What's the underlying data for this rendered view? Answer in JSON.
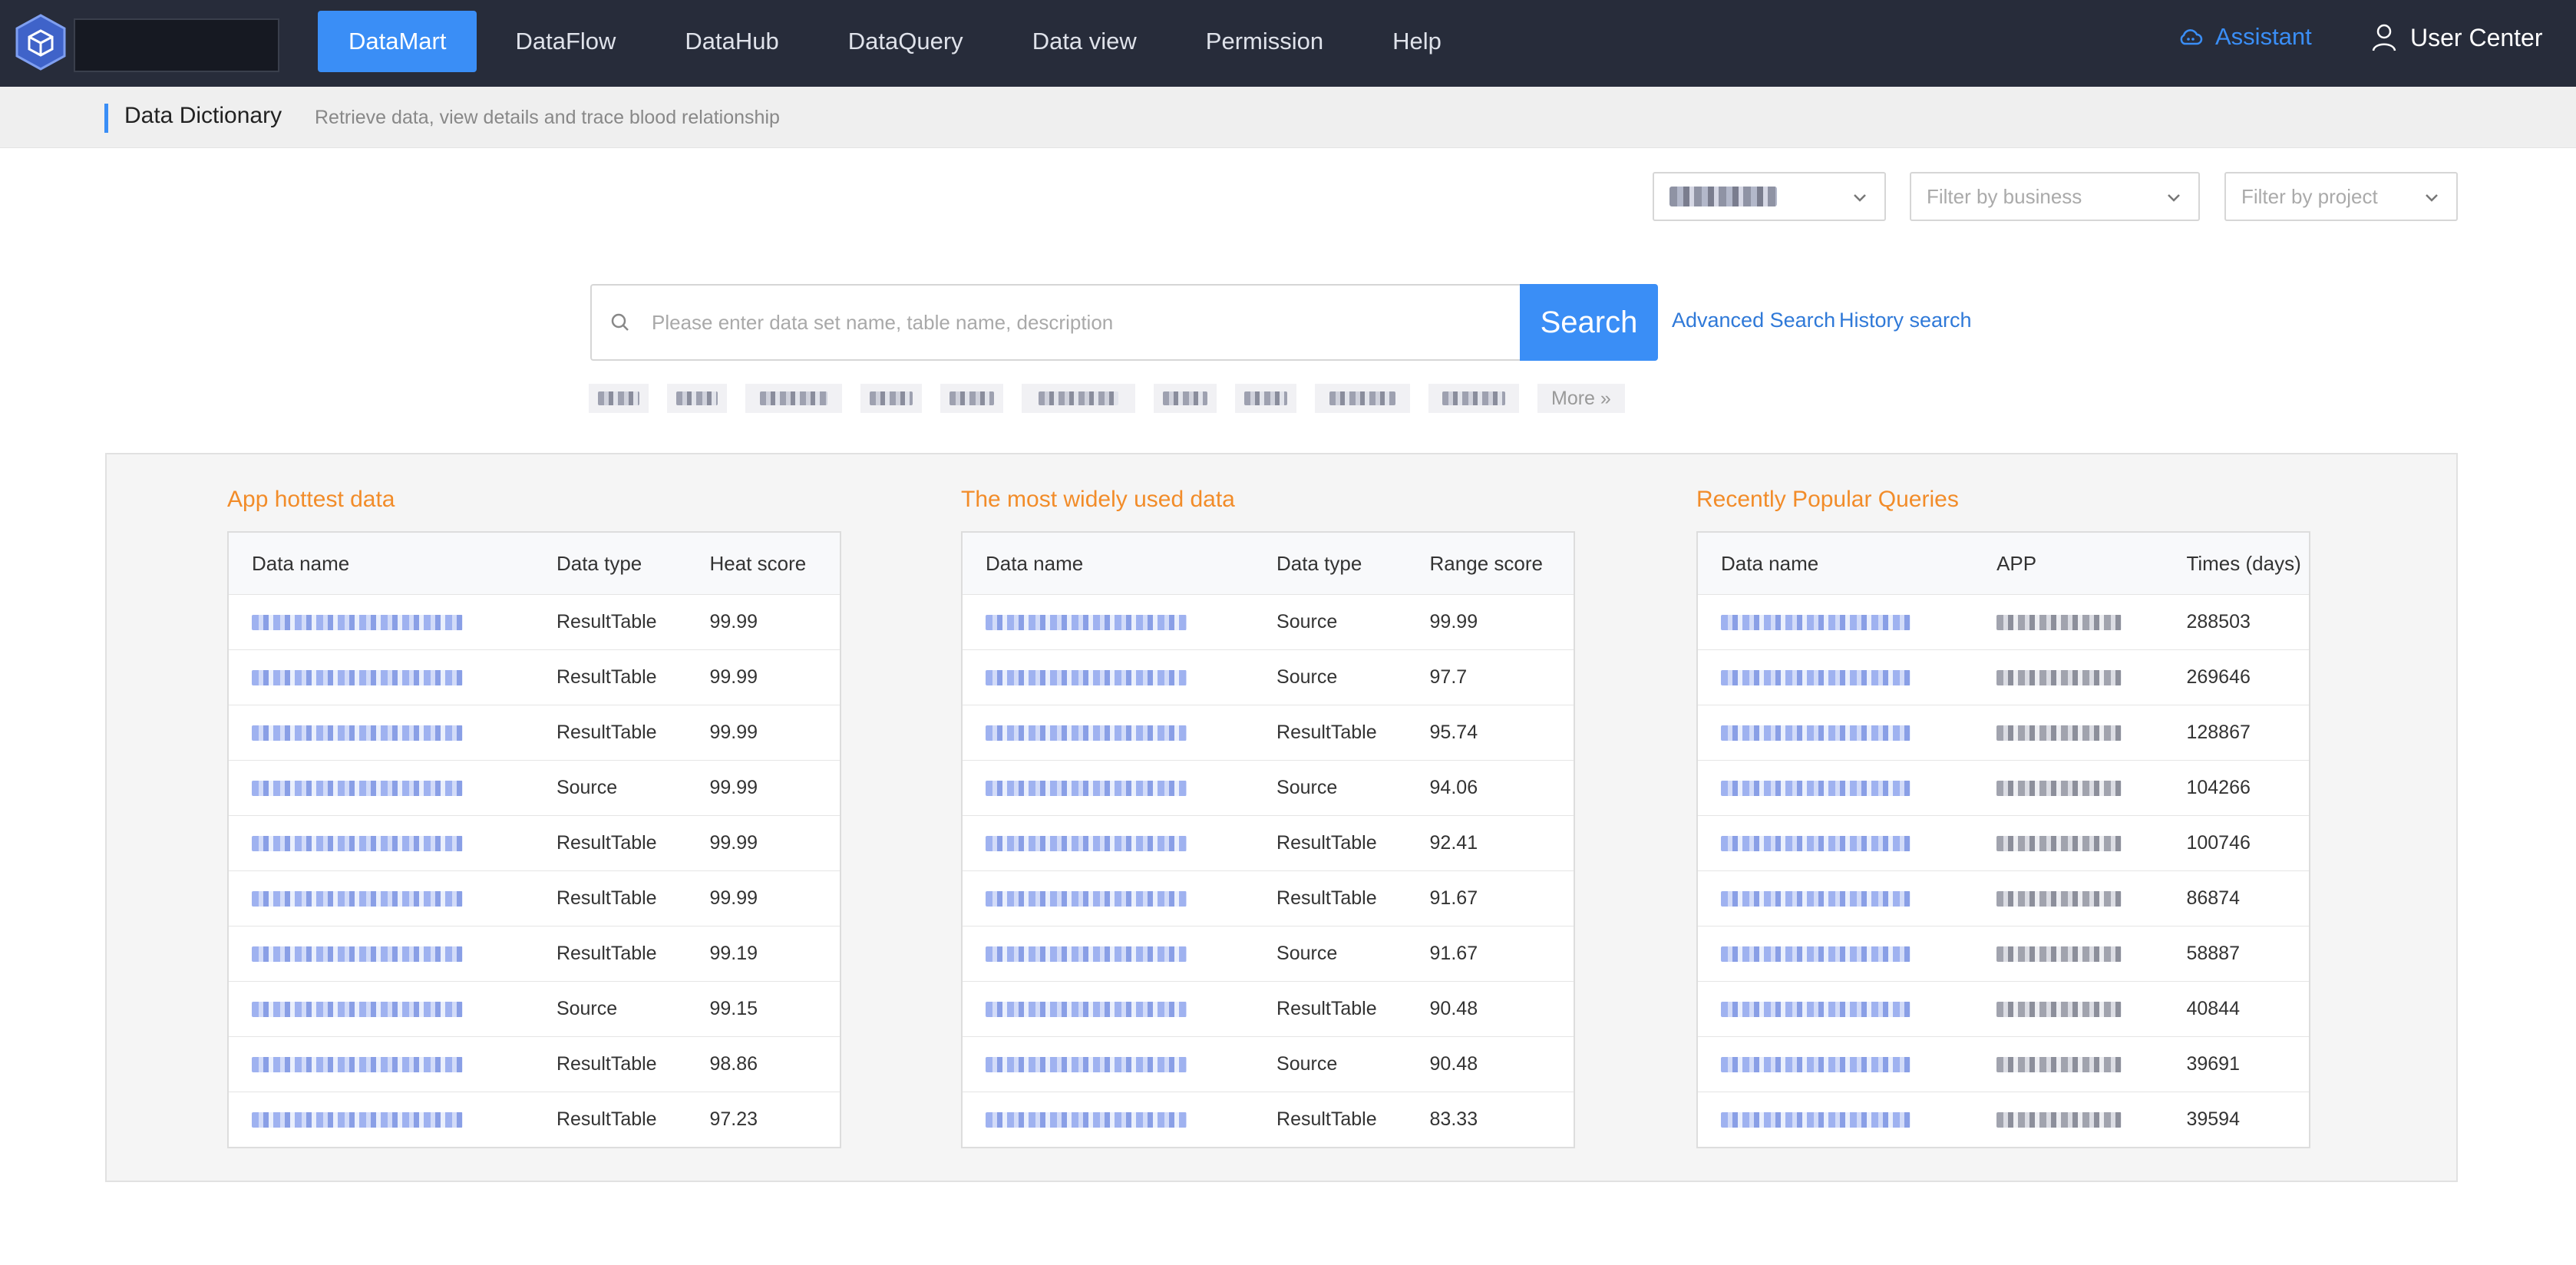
{
  "nav": {
    "items": [
      {
        "label": "DataMart",
        "active": true
      },
      {
        "label": "DataFlow",
        "active": false
      },
      {
        "label": "DataHub",
        "active": false
      },
      {
        "label": "DataQuery",
        "active": false
      },
      {
        "label": "Data view",
        "active": false
      },
      {
        "label": "Permission",
        "active": false
      },
      {
        "label": "Help",
        "active": false
      }
    ],
    "assistant": "Assistant",
    "user_center": "User Center",
    "accent_color": "#3a8ef6",
    "background_color": "#272c3a"
  },
  "subheader": {
    "title": "Data Dictionary",
    "description": "Retrieve data, view details and trace blood relationship"
  },
  "filters": {
    "first_value": "",
    "business_placeholder": "Filter by business",
    "project_placeholder": "Filter by project"
  },
  "search": {
    "placeholder": "Please enter data set name, table name, description",
    "button": "Search",
    "advanced": "Advanced Search",
    "history": "History search",
    "more_tag": "More »"
  },
  "hottest": {
    "title": "App hottest data",
    "columns": [
      "Data name",
      "Data type",
      "Heat score"
    ],
    "rows": [
      {
        "name": "",
        "type": "ResultTable",
        "score": "99.99"
      },
      {
        "name": "",
        "type": "ResultTable",
        "score": "99.99"
      },
      {
        "name": "",
        "type": "ResultTable",
        "score": "99.99"
      },
      {
        "name": "",
        "type": "Source",
        "score": "99.99"
      },
      {
        "name": "",
        "type": "ResultTable",
        "score": "99.99"
      },
      {
        "name": "",
        "type": "ResultTable",
        "score": "99.99"
      },
      {
        "name": "",
        "type": "ResultTable",
        "score": "99.19"
      },
      {
        "name": "",
        "type": "Source",
        "score": "99.15"
      },
      {
        "name": "",
        "type": "ResultTable",
        "score": "98.86"
      },
      {
        "name": "",
        "type": "ResultTable",
        "score": "97.23"
      }
    ]
  },
  "widely_used": {
    "title": "The most widely used data",
    "columns": [
      "Data name",
      "Data type",
      "Range score"
    ],
    "rows": [
      {
        "name": "",
        "type": "Source",
        "score": "99.99"
      },
      {
        "name": "",
        "type": "Source",
        "score": "97.7"
      },
      {
        "name": "",
        "type": "ResultTable",
        "score": "95.74"
      },
      {
        "name": "",
        "type": "Source",
        "score": "94.06"
      },
      {
        "name": "",
        "type": "ResultTable",
        "score": "92.41"
      },
      {
        "name": "",
        "type": "ResultTable",
        "score": "91.67"
      },
      {
        "name": "",
        "type": "Source",
        "score": "91.67"
      },
      {
        "name": "",
        "type": "ResultTable",
        "score": "90.48"
      },
      {
        "name": "",
        "type": "Source",
        "score": "90.48"
      },
      {
        "name": "",
        "type": "ResultTable",
        "score": "83.33"
      }
    ]
  },
  "popular_queries": {
    "title": "Recently Popular Queries",
    "columns": [
      "Data name",
      "APP",
      "Times (days)"
    ],
    "rows": [
      {
        "name": "",
        "app": "",
        "times": "288503"
      },
      {
        "name": "",
        "app": "",
        "times": "269646"
      },
      {
        "name": "",
        "app": "",
        "times": "128867"
      },
      {
        "name": "",
        "app": "",
        "times": "104266"
      },
      {
        "name": "",
        "app": "",
        "times": "100746"
      },
      {
        "name": "",
        "app": "",
        "times": "86874"
      },
      {
        "name": "",
        "app": "",
        "times": "58887"
      },
      {
        "name": "",
        "app": "",
        "times": "40844"
      },
      {
        "name": "",
        "app": "",
        "times": "39691"
      },
      {
        "name": "",
        "app": "",
        "times": "39594"
      }
    ]
  },
  "colors": {
    "accent": "#3a8ef6",
    "section_title": "#f28c29",
    "link": "#3a7fe0"
  }
}
